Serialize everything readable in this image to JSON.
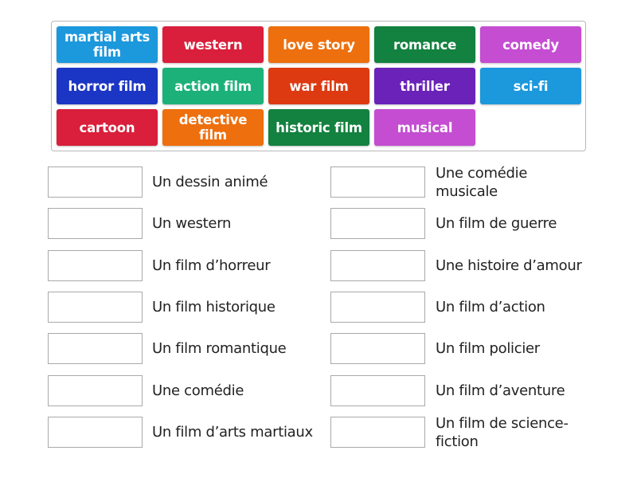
{
  "tile_bank": {
    "tiles": [
      {
        "label": "martial arts film",
        "color": "#1c98dc"
      },
      {
        "label": "western",
        "color": "#d91f3b"
      },
      {
        "label": "love story",
        "color": "#ee6f0d"
      },
      {
        "label": "romance",
        "color": "#13813f"
      },
      {
        "label": "comedy",
        "color": "#c44dd2"
      },
      {
        "label": "horror film",
        "color": "#1b35c4"
      },
      {
        "label": "action film",
        "color": "#1db17a"
      },
      {
        "label": "war film",
        "color": "#dd3a12"
      },
      {
        "label": "thriller",
        "color": "#6a22b9"
      },
      {
        "label": "sci-fi",
        "color": "#1c98dc"
      },
      {
        "label": "cartoon",
        "color": "#d91f3b"
      },
      {
        "label": "detective film",
        "color": "#ee6f0d"
      },
      {
        "label": "historic film",
        "color": "#13813f"
      },
      {
        "label": "musical",
        "color": "#c44dd2"
      }
    ]
  },
  "targets": {
    "left": [
      {
        "label": "Un dessin animé",
        "answer": ""
      },
      {
        "label": "Un western",
        "answer": ""
      },
      {
        "label": "Un film d’horreur",
        "answer": ""
      },
      {
        "label": "Un film historique",
        "answer": ""
      },
      {
        "label": "Un film romantique",
        "answer": ""
      },
      {
        "label": "Une comédie",
        "answer": ""
      },
      {
        "label": "Un film d’arts martiaux",
        "answer": ""
      }
    ],
    "right": [
      {
        "label": "Une comédie musicale",
        "answer": ""
      },
      {
        "label": "Un film de guerre",
        "answer": ""
      },
      {
        "label": "Une histoire d’amour",
        "answer": ""
      },
      {
        "label": "Un film d’action",
        "answer": ""
      },
      {
        "label": "Un film policier",
        "answer": ""
      },
      {
        "label": "Un film d’aventure",
        "answer": ""
      },
      {
        "label": "Un film de science-fiction",
        "answer": ""
      }
    ]
  }
}
